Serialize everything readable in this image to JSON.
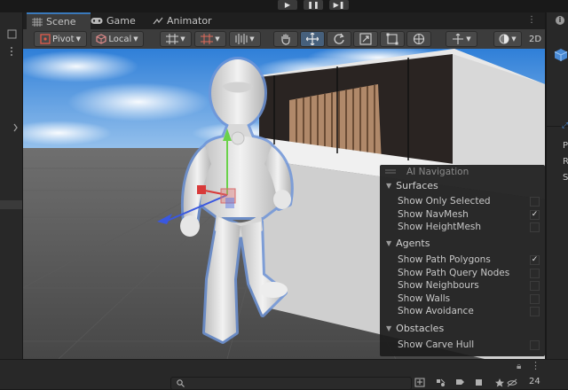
{
  "playbar": {
    "play": "▶",
    "pause": "❚❚",
    "step": "▶❚"
  },
  "tabs": [
    {
      "label": "Scene"
    },
    {
      "label": "Game"
    },
    {
      "label": "Animator"
    }
  ],
  "toolbar": {
    "pivot_label": "Pivot",
    "space_label": "Local",
    "view_mode_label": "2D"
  },
  "nav_overlay": {
    "title": "AI Navigation",
    "sections": [
      {
        "name": "Surfaces",
        "items": [
          {
            "label": "Show Only Selected",
            "checked": false
          },
          {
            "label": "Show NavMesh",
            "checked": true
          },
          {
            "label": "Show HeightMesh",
            "checked": false
          }
        ]
      },
      {
        "name": "Agents",
        "items": [
          {
            "label": "Show Path Polygons",
            "checked": true
          },
          {
            "label": "Show Path Query Nodes",
            "checked": false
          },
          {
            "label": "Show Neighbours",
            "checked": false
          },
          {
            "label": "Show Walls",
            "checked": false
          },
          {
            "label": "Show Avoidance",
            "checked": false
          }
        ]
      },
      {
        "name": "Obstacles",
        "items": [
          {
            "label": "Show Carve Hull",
            "checked": false
          }
        ]
      }
    ]
  },
  "right_panel": {
    "labels": [
      "P",
      "R",
      "S"
    ]
  },
  "bottom_bar": {
    "visibility_count": "24"
  },
  "colors": {
    "accent": "#3a79bb",
    "panel_bg": "#282828",
    "toolbar_bg": "#3c3c3c",
    "overlay_bg": "#1c1c1c"
  }
}
